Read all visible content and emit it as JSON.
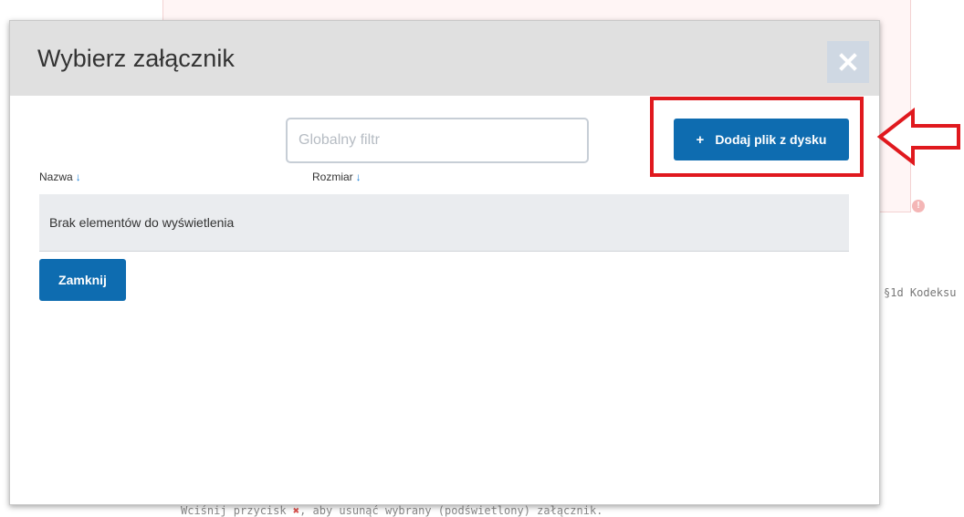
{
  "background": {
    "side_text": "§1d Kodeksu",
    "bottom_text_before": "Wciśnij przycisk",
    "bottom_text_icon": "✖",
    "bottom_text_after": ", aby usunąć wybrany (podświetlony) załącznik."
  },
  "modal": {
    "title": "Wybierz załącznik",
    "close_icon": "close-icon",
    "filter": {
      "placeholder": "Globalny filtr",
      "value": ""
    },
    "add_button": {
      "icon": "+",
      "label": "Dodaj plik z dysku"
    },
    "table": {
      "columns": [
        {
          "label": "Nazwa",
          "sort_icon": "↓"
        },
        {
          "label": "Rozmiar",
          "sort_icon": "↓"
        }
      ],
      "rows": [],
      "empty_message": "Brak elementów do wyświetlenia"
    },
    "footer": {
      "close_label": "Zamknij"
    }
  },
  "colors": {
    "primary": "#0e6cb0",
    "header_bg": "#e0e0e0",
    "annotation_red": "#e0191e"
  }
}
